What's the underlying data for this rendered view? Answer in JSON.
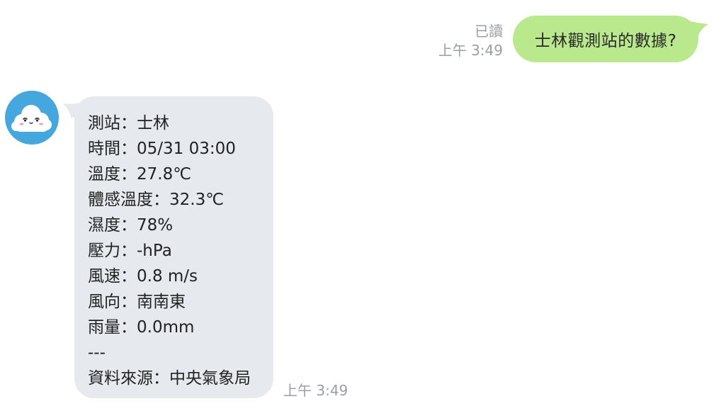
{
  "outgoing": {
    "read_label": "已讀",
    "time": "上午 3:49",
    "text": "士林觀測站的數據?",
    "bubble_color": "#b9e98c"
  },
  "incoming": {
    "avatar_icon": "cloud-face-icon",
    "avatar_color": "#46a6de",
    "bubble_color": "#e6e9ed",
    "lines": [
      "測站：士林",
      "時間：05/31 03:00",
      "溫度：27.8℃",
      "體感溫度：32.3℃",
      "濕度：78%",
      "壓力：-hPa",
      "風速：0.8 m/s",
      "風向：南南東",
      "雨量：0.0mm",
      "---",
      "資料來源：中央氣象局"
    ],
    "time": "上午 3:49"
  }
}
